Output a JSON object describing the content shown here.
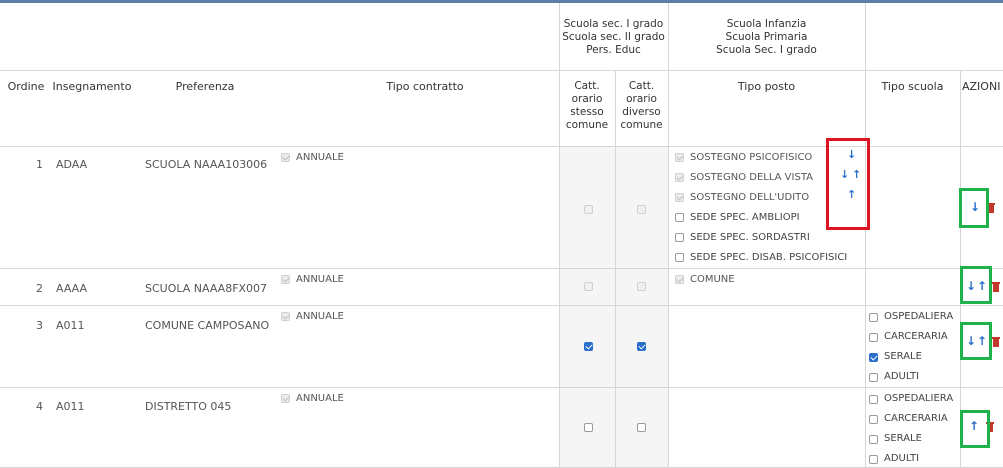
{
  "group_headers": {
    "sec": [
      "Scuola sec. I grado",
      "Scuola sec. II grado",
      "Pers. Educ"
    ],
    "inf": [
      "Scuola Infanzia",
      "Scuola Primaria",
      "Scuola Sec. I grado"
    ]
  },
  "columns": {
    "ordine": "Ordine",
    "insegnamento": "Insegnamento",
    "preferenza": "Preferenza",
    "tipo_contratto": "Tipo contratto",
    "catt_stesso": [
      "Catt.",
      "orario",
      "stesso",
      "comune"
    ],
    "catt_diverso": [
      "Catt.",
      "orario",
      "diverso",
      "comune"
    ],
    "tipo_posto": "Tipo posto",
    "tipo_scuola": "Tipo scuola",
    "azioni": "AZIONI"
  },
  "rows": [
    {
      "ordine": "1",
      "insegnamento": "ADAA",
      "preferenza": "SCUOLA NAAA103006",
      "contratto": "ANNUALE",
      "tipo_posto": [
        "SOSTEGNO PSICOFISICO",
        "SOSTEGNO DELLA VISTA",
        "SOSTEGNO DELL'UDITO",
        "SEDE SPEC. AMBLIOPI",
        "SEDE SPEC. SORDASTRI",
        "SEDE SPEC. DISAB. PSICOFISICI"
      ]
    },
    {
      "ordine": "2",
      "insegnamento": "AAAA",
      "preferenza": "SCUOLA NAAA8FX007",
      "contratto": "ANNUALE",
      "tipo_posto": [
        "COMUNE"
      ]
    },
    {
      "ordine": "3",
      "insegnamento": "A011",
      "preferenza": "COMUNE CAMPOSANO",
      "contratto": "ANNUALE",
      "tipo_scuola": [
        "OSPEDALIERA",
        "CARCERARIA",
        "SERALE",
        "ADULTI"
      ]
    },
    {
      "ordine": "4",
      "insegnamento": "A011",
      "preferenza": "DISTRETTO 045",
      "contratto": "ANNUALE",
      "tipo_scuola": [
        "OSPEDALIERA",
        "CARCERARIA",
        "SERALE",
        "ADULTI"
      ]
    }
  ],
  "colors": {
    "accent": "#2a6fcb",
    "highlight_red": "#e0141e",
    "highlight_green": "#1fb24a",
    "trash": "#c0392b"
  },
  "icons": {
    "down": "arrow-down-icon",
    "up": "arrow-up-icon",
    "delete": "trash-icon"
  }
}
